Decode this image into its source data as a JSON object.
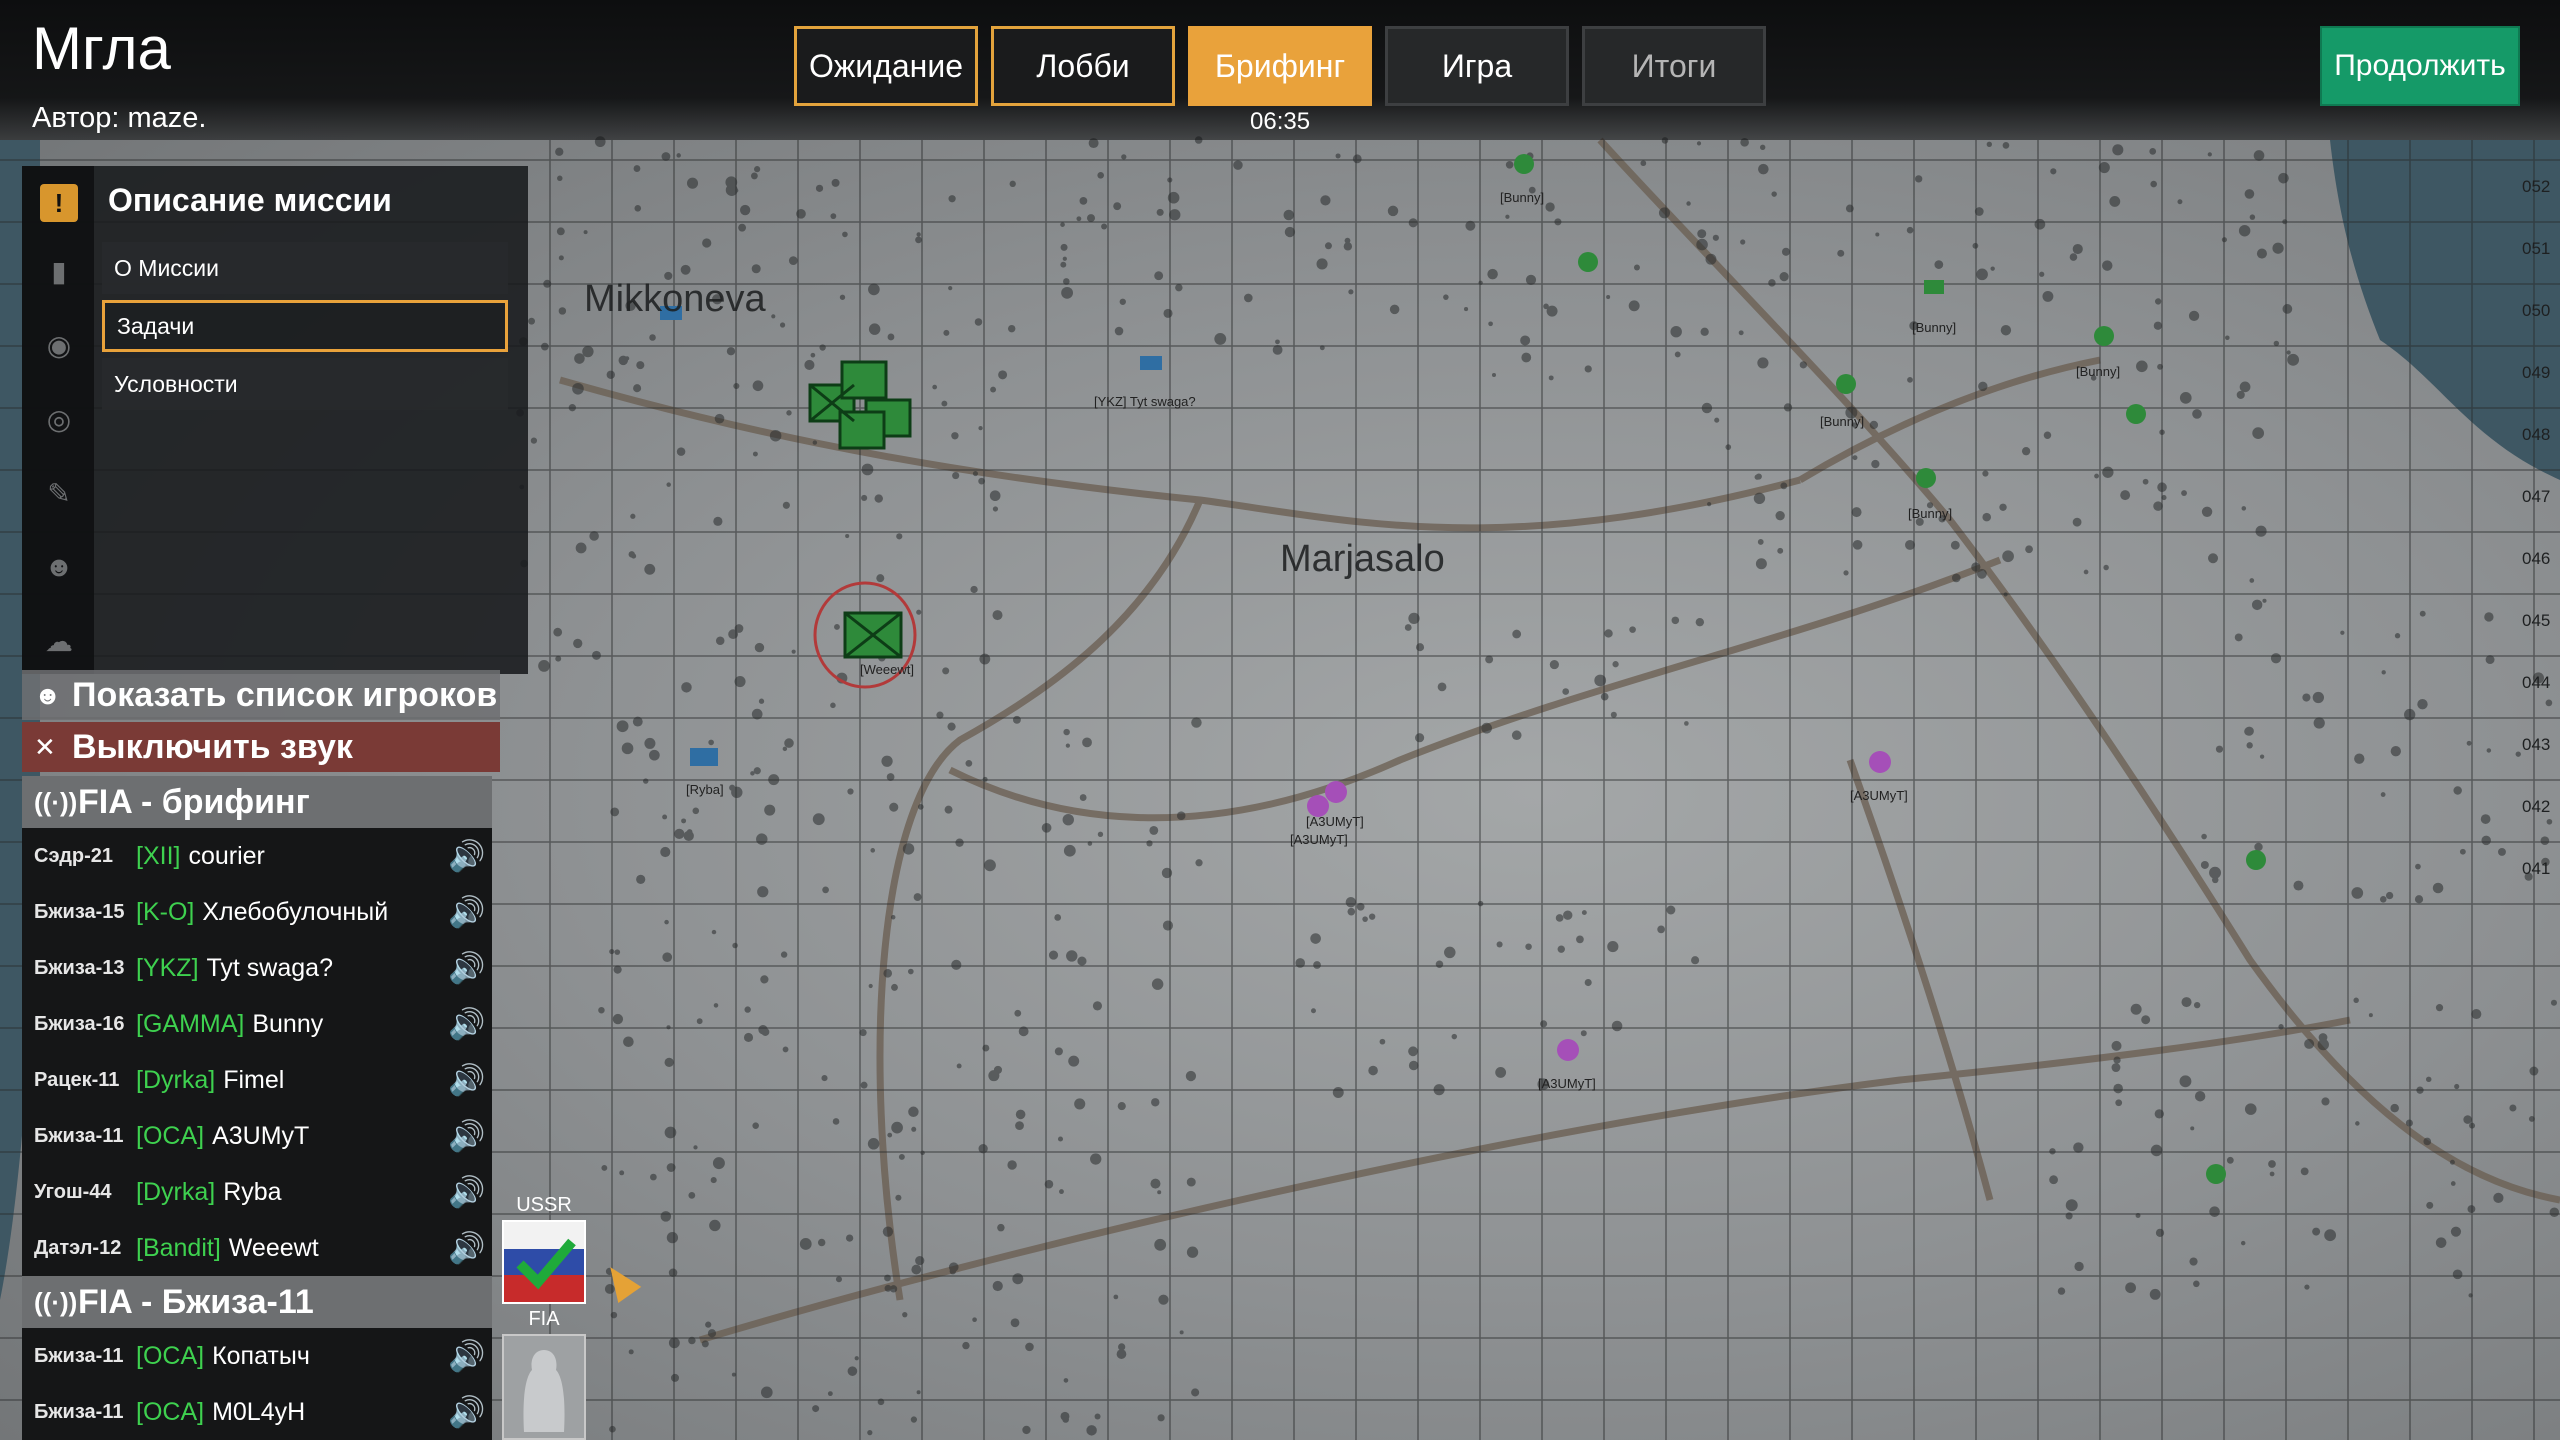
{
  "header": {
    "title": "Мгла",
    "author": "Автор: maze.",
    "timer": "06:35",
    "continue_label": "Продолжить",
    "phases": [
      {
        "label": "Ожидание",
        "state": "done"
      },
      {
        "label": "Лобби",
        "state": "done"
      },
      {
        "label": "Брифинг",
        "state": "active"
      },
      {
        "label": "Игра",
        "state": "future"
      },
      {
        "label": "Итоги",
        "state": "locked"
      }
    ]
  },
  "briefing": {
    "header": "Описание миссии",
    "items": [
      "О Миссии",
      "Задачи",
      "Условности"
    ],
    "selected": "Задачи",
    "icons": [
      "info-icon",
      "marker-icon",
      "compass-icon",
      "target-icon",
      "pencil-icon",
      "players-icon",
      "cloud-icon"
    ]
  },
  "actions": {
    "show_players": "Показать список игроков",
    "mute_all": "Выключить звук"
  },
  "groups": [
    {
      "name": "FIA - брифинг",
      "players": [
        {
          "callsign": "Сэдр-21",
          "tag": "[XII]",
          "name": "courier"
        },
        {
          "callsign": "Бжиза-15",
          "tag": "[K-O]",
          "name": "Хлебобулочный"
        },
        {
          "callsign": "Бжиза-13",
          "tag": "[YKZ]",
          "name": "Tyt swaga?"
        },
        {
          "callsign": "Бжиза-16",
          "tag": "[GAMMA]",
          "name": "Bunny"
        },
        {
          "callsign": "Рацек-11",
          "tag": "[Dyrka]",
          "name": "Fimel"
        },
        {
          "callsign": "Бжиза-11",
          "tag": "[OCA]",
          "name": "A3UMyT"
        },
        {
          "callsign": "Угош-44",
          "tag": "[Dyrka]",
          "name": "Ryba"
        },
        {
          "callsign": "Датэл-12",
          "tag": "[Bandit]",
          "name": "Weeewt"
        }
      ]
    },
    {
      "name": "FIA - Бжиза-11",
      "players": [
        {
          "callsign": "Бжиза-11",
          "tag": "[OCA]",
          "name": "Копатыч"
        },
        {
          "callsign": "Бжиза-11",
          "tag": "[OCA]",
          "name": "M0L4yH"
        }
      ]
    }
  ],
  "sides": {
    "ussr": "USSR",
    "fia": "FIA"
  },
  "map": {
    "towns": [
      "Mikkoneva",
      "Marjasalo"
    ],
    "unit_tags": [
      "[YKZ] Tyt swaga?",
      "[Bunny]",
      "[Weeewt]",
      "[Ryba]",
      "[A3UMyT]",
      "[A3UMyT]",
      "[A3UMyT]",
      "[A3UMyT]",
      "[Bunny]",
      "[Bunny]",
      "[Bunny]",
      "[Bunny]"
    ],
    "grid_labels": [
      "052",
      "051",
      "050",
      "049",
      "048",
      "047",
      "046",
      "045",
      "044",
      "043",
      "042",
      "041"
    ]
  },
  "colors": {
    "accent": "#e9a23b",
    "continue": "#159a68",
    "mute_bg": "#7a3a36",
    "tag_green": "#3ed14f",
    "marker_green": "#2e8a3a",
    "marker_purple": "#a54fb8"
  }
}
